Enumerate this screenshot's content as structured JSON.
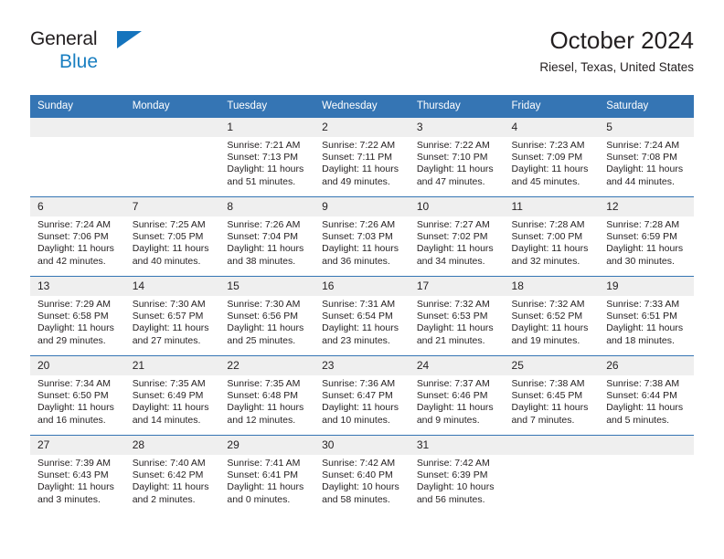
{
  "brand": {
    "line1": "General",
    "line2": "Blue",
    "triangle_icon": "triangle-icon",
    "color_dark": "#231f20",
    "color_blue": "#1a7fc1"
  },
  "header": {
    "title": "October 2024",
    "subtitle": "Riesel, Texas, United States"
  },
  "theme": {
    "header_blue": "#3575b4",
    "daynum_band": "#efefef",
    "text": "#231f20"
  },
  "calendar": {
    "weekday_headers": [
      "Sunday",
      "Monday",
      "Tuesday",
      "Wednesday",
      "Thursday",
      "Friday",
      "Saturday"
    ],
    "labels": {
      "sunrise": "Sunrise:",
      "sunset": "Sunset:",
      "daylight": "Daylight:"
    },
    "weeks": [
      [
        {
          "day": "",
          "empty": true
        },
        {
          "day": "",
          "empty": true
        },
        {
          "day": "1",
          "sunrise": "Sunrise: 7:21 AM",
          "sunset": "Sunset: 7:13 PM",
          "daylight": "Daylight: 11 hours and 51 minutes."
        },
        {
          "day": "2",
          "sunrise": "Sunrise: 7:22 AM",
          "sunset": "Sunset: 7:11 PM",
          "daylight": "Daylight: 11 hours and 49 minutes."
        },
        {
          "day": "3",
          "sunrise": "Sunrise: 7:22 AM",
          "sunset": "Sunset: 7:10 PM",
          "daylight": "Daylight: 11 hours and 47 minutes."
        },
        {
          "day": "4",
          "sunrise": "Sunrise: 7:23 AM",
          "sunset": "Sunset: 7:09 PM",
          "daylight": "Daylight: 11 hours and 45 minutes."
        },
        {
          "day": "5",
          "sunrise": "Sunrise: 7:24 AM",
          "sunset": "Sunset: 7:08 PM",
          "daylight": "Daylight: 11 hours and 44 minutes."
        }
      ],
      [
        {
          "day": "6",
          "sunrise": "Sunrise: 7:24 AM",
          "sunset": "Sunset: 7:06 PM",
          "daylight": "Daylight: 11 hours and 42 minutes."
        },
        {
          "day": "7",
          "sunrise": "Sunrise: 7:25 AM",
          "sunset": "Sunset: 7:05 PM",
          "daylight": "Daylight: 11 hours and 40 minutes."
        },
        {
          "day": "8",
          "sunrise": "Sunrise: 7:26 AM",
          "sunset": "Sunset: 7:04 PM",
          "daylight": "Daylight: 11 hours and 38 minutes."
        },
        {
          "day": "9",
          "sunrise": "Sunrise: 7:26 AM",
          "sunset": "Sunset: 7:03 PM",
          "daylight": "Daylight: 11 hours and 36 minutes."
        },
        {
          "day": "10",
          "sunrise": "Sunrise: 7:27 AM",
          "sunset": "Sunset: 7:02 PM",
          "daylight": "Daylight: 11 hours and 34 minutes."
        },
        {
          "day": "11",
          "sunrise": "Sunrise: 7:28 AM",
          "sunset": "Sunset: 7:00 PM",
          "daylight": "Daylight: 11 hours and 32 minutes."
        },
        {
          "day": "12",
          "sunrise": "Sunrise: 7:28 AM",
          "sunset": "Sunset: 6:59 PM",
          "daylight": "Daylight: 11 hours and 30 minutes."
        }
      ],
      [
        {
          "day": "13",
          "sunrise": "Sunrise: 7:29 AM",
          "sunset": "Sunset: 6:58 PM",
          "daylight": "Daylight: 11 hours and 29 minutes."
        },
        {
          "day": "14",
          "sunrise": "Sunrise: 7:30 AM",
          "sunset": "Sunset: 6:57 PM",
          "daylight": "Daylight: 11 hours and 27 minutes."
        },
        {
          "day": "15",
          "sunrise": "Sunrise: 7:30 AM",
          "sunset": "Sunset: 6:56 PM",
          "daylight": "Daylight: 11 hours and 25 minutes."
        },
        {
          "day": "16",
          "sunrise": "Sunrise: 7:31 AM",
          "sunset": "Sunset: 6:54 PM",
          "daylight": "Daylight: 11 hours and 23 minutes."
        },
        {
          "day": "17",
          "sunrise": "Sunrise: 7:32 AM",
          "sunset": "Sunset: 6:53 PM",
          "daylight": "Daylight: 11 hours and 21 minutes."
        },
        {
          "day": "18",
          "sunrise": "Sunrise: 7:32 AM",
          "sunset": "Sunset: 6:52 PM",
          "daylight": "Daylight: 11 hours and 19 minutes."
        },
        {
          "day": "19",
          "sunrise": "Sunrise: 7:33 AM",
          "sunset": "Sunset: 6:51 PM",
          "daylight": "Daylight: 11 hours and 18 minutes."
        }
      ],
      [
        {
          "day": "20",
          "sunrise": "Sunrise: 7:34 AM",
          "sunset": "Sunset: 6:50 PM",
          "daylight": "Daylight: 11 hours and 16 minutes."
        },
        {
          "day": "21",
          "sunrise": "Sunrise: 7:35 AM",
          "sunset": "Sunset: 6:49 PM",
          "daylight": "Daylight: 11 hours and 14 minutes."
        },
        {
          "day": "22",
          "sunrise": "Sunrise: 7:35 AM",
          "sunset": "Sunset: 6:48 PM",
          "daylight": "Daylight: 11 hours and 12 minutes."
        },
        {
          "day": "23",
          "sunrise": "Sunrise: 7:36 AM",
          "sunset": "Sunset: 6:47 PM",
          "daylight": "Daylight: 11 hours and 10 minutes."
        },
        {
          "day": "24",
          "sunrise": "Sunrise: 7:37 AM",
          "sunset": "Sunset: 6:46 PM",
          "daylight": "Daylight: 11 hours and 9 minutes."
        },
        {
          "day": "25",
          "sunrise": "Sunrise: 7:38 AM",
          "sunset": "Sunset: 6:45 PM",
          "daylight": "Daylight: 11 hours and 7 minutes."
        },
        {
          "day": "26",
          "sunrise": "Sunrise: 7:38 AM",
          "sunset": "Sunset: 6:44 PM",
          "daylight": "Daylight: 11 hours and 5 minutes."
        }
      ],
      [
        {
          "day": "27",
          "sunrise": "Sunrise: 7:39 AM",
          "sunset": "Sunset: 6:43 PM",
          "daylight": "Daylight: 11 hours and 3 minutes."
        },
        {
          "day": "28",
          "sunrise": "Sunrise: 7:40 AM",
          "sunset": "Sunset: 6:42 PM",
          "daylight": "Daylight: 11 hours and 2 minutes."
        },
        {
          "day": "29",
          "sunrise": "Sunrise: 7:41 AM",
          "sunset": "Sunset: 6:41 PM",
          "daylight": "Daylight: 11 hours and 0 minutes."
        },
        {
          "day": "30",
          "sunrise": "Sunrise: 7:42 AM",
          "sunset": "Sunset: 6:40 PM",
          "daylight": "Daylight: 10 hours and 58 minutes."
        },
        {
          "day": "31",
          "sunrise": "Sunrise: 7:42 AM",
          "sunset": "Sunset: 6:39 PM",
          "daylight": "Daylight: 10 hours and 56 minutes."
        },
        {
          "day": "",
          "empty": true
        },
        {
          "day": "",
          "empty": true
        }
      ]
    ]
  }
}
